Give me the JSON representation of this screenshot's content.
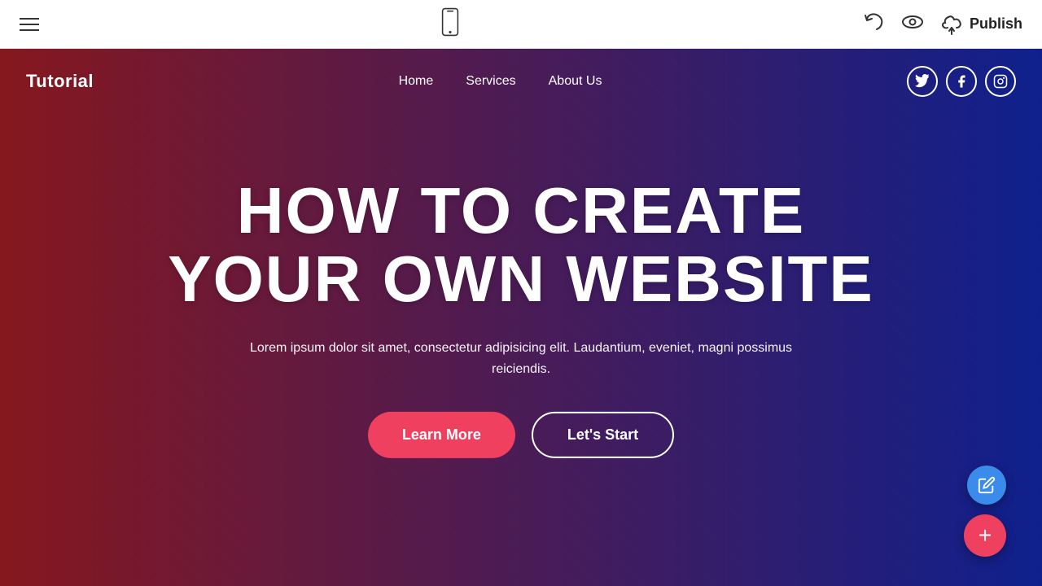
{
  "toolbar": {
    "hamburger_label": "menu",
    "undo_label": "undo",
    "eye_label": "preview",
    "publish_label": "Publish"
  },
  "site": {
    "logo": "Tutorial",
    "nav": {
      "items": [
        {
          "id": "home",
          "label": "Home"
        },
        {
          "id": "services",
          "label": "Services"
        },
        {
          "id": "about",
          "label": "About Us"
        }
      ]
    },
    "social": {
      "twitter_label": "Twitter",
      "facebook_label": "Facebook",
      "instagram_label": "Instagram"
    },
    "hero": {
      "title_line1": "HOW TO CREATE",
      "title_line2": "YOUR OWN WEBSITE",
      "subtitle": "Lorem ipsum dolor sit amet, consectetur adipisicing elit. Laudantium, eveniet, magni possimus reiciendis.",
      "btn_learn_more": "Learn More",
      "btn_lets_start": "Let's Start"
    }
  },
  "fab": {
    "pencil_label": "edit",
    "plus_label": "add"
  }
}
